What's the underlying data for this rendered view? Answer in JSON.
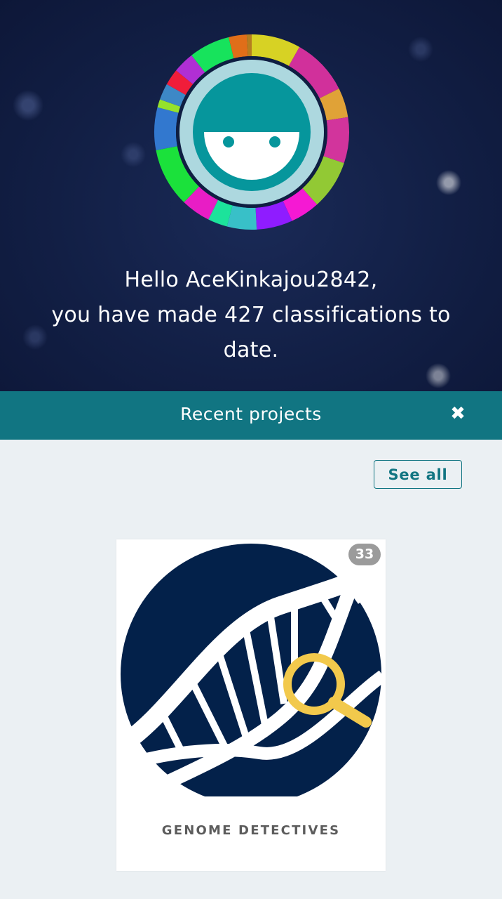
{
  "hero": {
    "greeting_line1": "Hello AceKinkajou2842,",
    "greeting_line2": "you have made 427 classifications to date."
  },
  "avatar": {
    "icon": "zooniverse-avatar-icon",
    "colors": {
      "face": "#06969c",
      "face_ring": "#add8df",
      "ring_border": "#0f1e42"
    }
  },
  "recent_projects": {
    "title": "Recent projects",
    "close_icon": "close-icon",
    "see_all_label": "See all",
    "accent": "#117582",
    "projects": [
      {
        "name": "GENOME DETECTIVES",
        "count": "33",
        "icon": "dna-magnifier-icon"
      }
    ]
  }
}
